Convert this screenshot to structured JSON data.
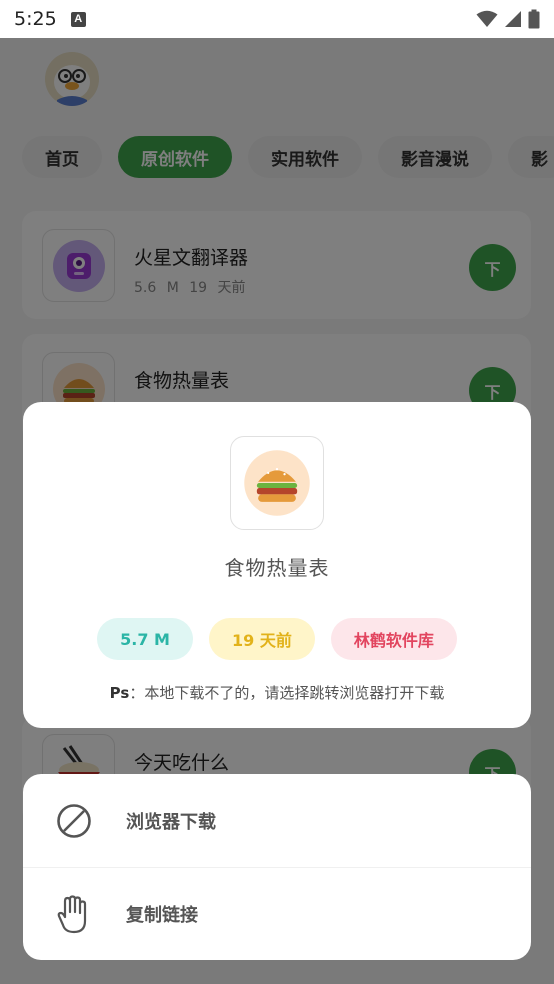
{
  "status_bar": {
    "time": "5:25",
    "notif_icon": "A"
  },
  "tabs": [
    {
      "label": "首页"
    },
    {
      "label": "原创软件"
    },
    {
      "label": "实用软件"
    },
    {
      "label": "影音漫说"
    },
    {
      "label": "影"
    }
  ],
  "apps": [
    {
      "name": "火星文翻译器",
      "size": "5.6 M",
      "time": "19 天前",
      "button": "下"
    },
    {
      "name": "食物热量表",
      "button": "下"
    },
    {
      "name": "今天吃什么",
      "button": "下"
    }
  ],
  "dialog": {
    "title": "食物热量表",
    "tags": {
      "size": "5.7 M",
      "time": "19 天前",
      "source": "林鹤软件库"
    },
    "note_prefix": "Ps",
    "note": "：本地下载不了的，请选择跳转浏览器打开下载"
  },
  "sheet": {
    "browser_label": "浏览器下载",
    "copy_label": "复制链接"
  },
  "colors": {
    "accent": "#3fa64d",
    "size_tag": "#2bb5a6",
    "time_tag": "#e2b21a",
    "source_tag": "#e2455f"
  }
}
